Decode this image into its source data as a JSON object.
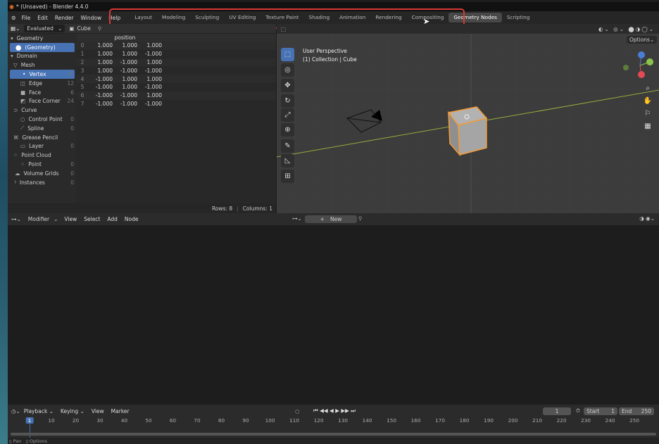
{
  "window": {
    "title": "* (Unsaved) - Blender 4.4.0"
  },
  "menu": [
    "File",
    "Edit",
    "Render",
    "Window",
    "Help"
  ],
  "workspaces": [
    "Layout",
    "Modeling",
    "Sculpting",
    "UV Editing",
    "Texture Paint",
    "Shading",
    "Animation",
    "Rendering",
    "Compositing",
    "Geometry Nodes",
    "Scripting"
  ],
  "active_workspace": "Geometry Nodes",
  "spreadsheet": {
    "mode": "Evaluated",
    "object": "Cube",
    "column_header": "position",
    "sidebar": [
      {
        "label": "Geometry",
        "count": ""
      },
      {
        "label": "(Geometry)",
        "count": ""
      },
      {
        "label": "Domain",
        "count": ""
      },
      {
        "label": "Mesh",
        "count": ""
      },
      {
        "label": "Vertex",
        "count": "8"
      },
      {
        "label": "Edge",
        "count": "12"
      },
      {
        "label": "Face",
        "count": "6"
      },
      {
        "label": "Face Corner",
        "count": "24"
      },
      {
        "label": "Curve",
        "count": ""
      },
      {
        "label": "Control Point",
        "count": "0"
      },
      {
        "label": "Spline",
        "count": "0"
      },
      {
        "label": "Grease Pencil",
        "count": ""
      },
      {
        "label": "Layer",
        "count": "0"
      },
      {
        "label": "Point Cloud",
        "count": ""
      },
      {
        "label": "Point",
        "count": "0"
      },
      {
        "label": "Volume Grids",
        "count": "0"
      },
      {
        "label": "Instances",
        "count": "0"
      }
    ],
    "rows": [
      [
        "0",
        "1.000",
        "1.000",
        "1.000"
      ],
      [
        "1",
        "1.000",
        "1.000",
        "-1.000"
      ],
      [
        "2",
        "1.000",
        "-1.000",
        "1.000"
      ],
      [
        "3",
        "1.000",
        "-1.000",
        "-1.000"
      ],
      [
        "4",
        "-1.000",
        "1.000",
        "1.000"
      ],
      [
        "5",
        "-1.000",
        "1.000",
        "-1.000"
      ],
      [
        "6",
        "-1.000",
        "-1.000",
        "1.000"
      ],
      [
        "7",
        "-1.000",
        "-1.000",
        "-1.000"
      ]
    ],
    "footer": {
      "rows": "Rows: 8",
      "columns": "Columns: 1"
    }
  },
  "viewport": {
    "line1": "User Perspective",
    "line2": "(1) Collection | Cube",
    "options": "Options"
  },
  "node_editor": {
    "mode": "Modifier",
    "menus": [
      "View",
      "Select",
      "Add",
      "Node"
    ],
    "new_label": "New"
  },
  "timeline": {
    "menus": [
      "Playback",
      "Keying",
      "View",
      "Marker"
    ],
    "current_frame": "1",
    "start_label": "Start",
    "start": "1",
    "end_label": "End",
    "end": "250",
    "ticks": [
      "1",
      "10",
      "20",
      "30",
      "40",
      "50",
      "60",
      "70",
      "80",
      "90",
      "100",
      "110",
      "120",
      "130",
      "140",
      "150",
      "160",
      "170",
      "180",
      "190",
      "200",
      "210",
      "220",
      "230",
      "240",
      "250"
    ]
  },
  "status": {
    "left": "Pan",
    "right": "Options"
  }
}
